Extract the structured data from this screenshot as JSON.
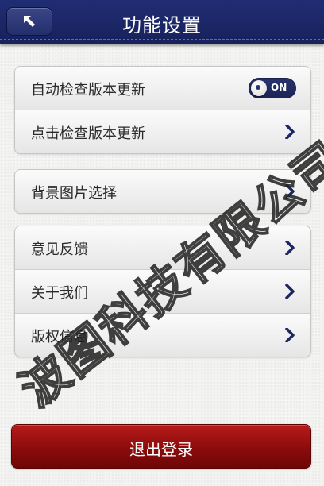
{
  "header": {
    "title": "功能设置",
    "back_icon": "back-arrow-icon",
    "bg_color": "#1c2664"
  },
  "groups": [
    {
      "items": [
        {
          "label": "自动检查版本更新",
          "toggle": {
            "state": "on",
            "text": "ON"
          }
        },
        {
          "label": "点击检查版本更新",
          "icon": "chevron-right-icon"
        }
      ]
    },
    {
      "items": [
        {
          "label": "背景图片选择",
          "icon": "chevron-right-icon"
        }
      ]
    },
    {
      "items": [
        {
          "label": "意见反馈",
          "icon": "chevron-right-icon"
        },
        {
          "label": "关于我们",
          "icon": "chevron-right-icon"
        },
        {
          "label": "版权信息",
          "icon": "chevron-right-icon"
        }
      ]
    }
  ],
  "logout": {
    "label": "退出登录",
    "color": "#9e1111"
  },
  "watermark": {
    "text": "波图科技有限公司"
  },
  "colors": {
    "accent": "#1c2664",
    "chevron": "#1c2664"
  }
}
